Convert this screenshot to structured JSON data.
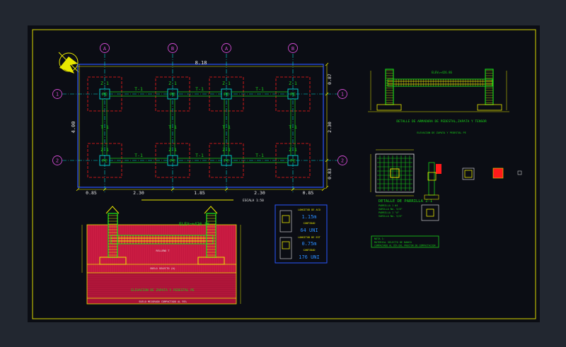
{
  "colors": {
    "background": "#222730",
    "sheet": "#0b0d14",
    "frame": "#d8d800",
    "cyan": "#00d8d8",
    "red": "#ff1a1a",
    "yellow": "#e8e800",
    "green": "#18d018",
    "white": "#e8e8e8",
    "magenta": "#d04ad0",
    "blue": "#2a56ff"
  },
  "plan": {
    "column_axes": [
      "A",
      "B",
      "A",
      "B"
    ],
    "row_axes": [
      "1",
      "2"
    ],
    "overall_width": "8.18",
    "overall_height": "4.00",
    "bottom_dims": [
      "0.85",
      "2.30",
      "1.85",
      "2.30",
      "0.85"
    ],
    "right_dims": [
      "0.87",
      "2.30",
      "0.83"
    ],
    "footing_tag": "Z-1",
    "pedestal_tag": "PE",
    "beam_tag": "T-1",
    "scale_label": "ESCALA 1:50"
  },
  "section_main": {
    "elevation_label": "ELEV=+426.86",
    "soil_label_1": "RELLENO T",
    "soil_label_2": "SUELO SELECTO (A)",
    "soil_label_3": "SUELO MEJORADO COMPACTADO AL 95%",
    "title": "ELEVACION DE ZAPATA Y PEDESTAL PE"
  },
  "quantities": {
    "steel_length_label": "LONGITUD DE ACO",
    "steel_length_value": "1.15m",
    "steel_qty_label": "CANTIDAD",
    "steel_qty_value": "64 UNI",
    "stirrup_length_label": "LONGITUD DE EST",
    "stirrup_length_value": "0.75m",
    "stirrup_qty_label": "CANTIDAD",
    "stirrup_qty_value": "176 UNI"
  },
  "tie_detail": {
    "elevation_label": "ELEV=+426.86",
    "title": "DETALLE DE ARMADURA DE PEDESTAL,ZAPATA Y TENSOR",
    "subtitle": "ELEVACION DE ZAPATA Y PEDESTAL PE"
  },
  "grid_detail": {
    "title": "DETALLE DE PARRILLA Z-1",
    "notes": [
      "PARRILLA 1 #4",
      "VARILLA No. 5/8\"",
      "PARRILLA 1 \"A\"",
      "VARILLA No. 5/8\""
    ]
  },
  "note": {
    "title": "NOTA 1:",
    "line1": "MATERIAL SELECTO DE BANCO",
    "line2": "COMPACTADO AL 95% DEL PROCTOR DE COMPACTACION"
  }
}
